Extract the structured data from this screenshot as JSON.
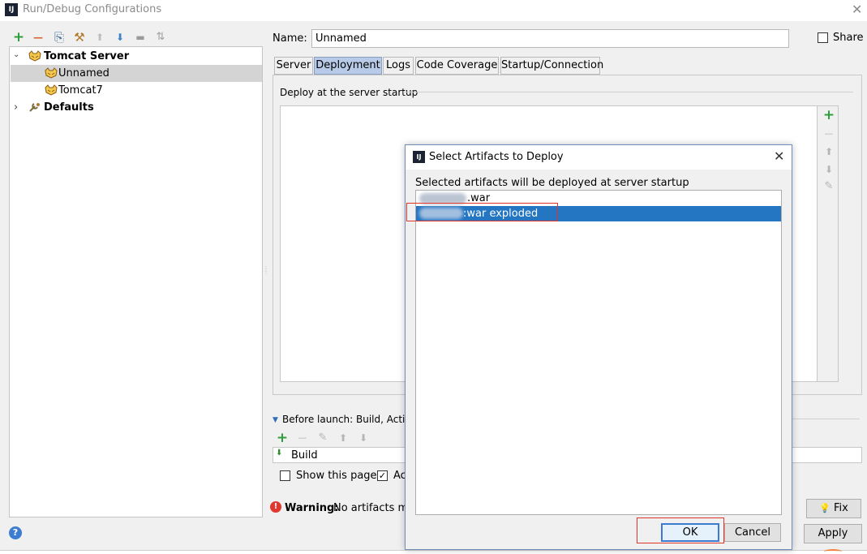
{
  "window": {
    "title": "Run/Debug Configurations",
    "app_icon": "IJ",
    "close_glyph": "✕"
  },
  "toolbar": {
    "add_glyph": "+",
    "remove_glyph": "—",
    "copy_glyph": "⎘",
    "settings_glyph": "⚒",
    "up_glyph": "⬆",
    "down_glyph": "⬇",
    "folder_glyph": "▬",
    "sort_glyph": "⇅"
  },
  "tree": {
    "items": [
      {
        "label": "Tomcat Server",
        "arrow": "⌄"
      },
      {
        "label": "Unnamed"
      },
      {
        "label": "Tomcat7"
      },
      {
        "label": "Defaults",
        "arrow": "›"
      }
    ]
  },
  "config": {
    "name_label": "Name:",
    "name_value": "Unnamed",
    "share_label": "Share",
    "tabs": [
      {
        "label": "Server"
      },
      {
        "label": "Deployment"
      },
      {
        "label": "Logs"
      },
      {
        "label": "Code Coverage"
      },
      {
        "label": "Startup/Connection"
      }
    ],
    "deploy_title": "Deploy at the server startup",
    "deploy_tools": {
      "add": "+",
      "remove": "—",
      "up": "⬆",
      "down": "⬇",
      "edit": "✎"
    },
    "before_launch_arrow": "▼",
    "before_launch_label": "Before launch: Build, Activate",
    "before_tools": {
      "add": "+",
      "remove": "—",
      "edit": "✎",
      "up": "⬆",
      "down": "⬇"
    },
    "build_icon": "⬇",
    "build_label": "Build",
    "show_page_label": "Show this page",
    "activate_label": "Ac",
    "warning_label": "Warning:",
    "warning_text": "No artifacts ma",
    "warning_icon": "!",
    "fix_label": "Fix",
    "fix_icon": "💡",
    "apply_label": "Apply",
    "help_icon": "?"
  },
  "dialog": {
    "app_icon": "IJ",
    "title": "Select Artifacts to Deploy",
    "close_glyph": "✕",
    "description": "Selected artifacts will be deployed at server startup",
    "artifacts": [
      {
        "label": ".war",
        "selected": false
      },
      {
        "label": ":war exploded",
        "selected": true
      }
    ],
    "ok_label": "OK",
    "cancel_label": "Cancel"
  },
  "colors": {
    "selection": "#2475c2",
    "active_tab": "#b7cbe8",
    "add_green": "#2f9e3b",
    "remove_orange": "#d9602c",
    "arrow_blue": "#3a83c9",
    "highlight_red": "#e0352b",
    "warning_red": "#e1372e"
  }
}
